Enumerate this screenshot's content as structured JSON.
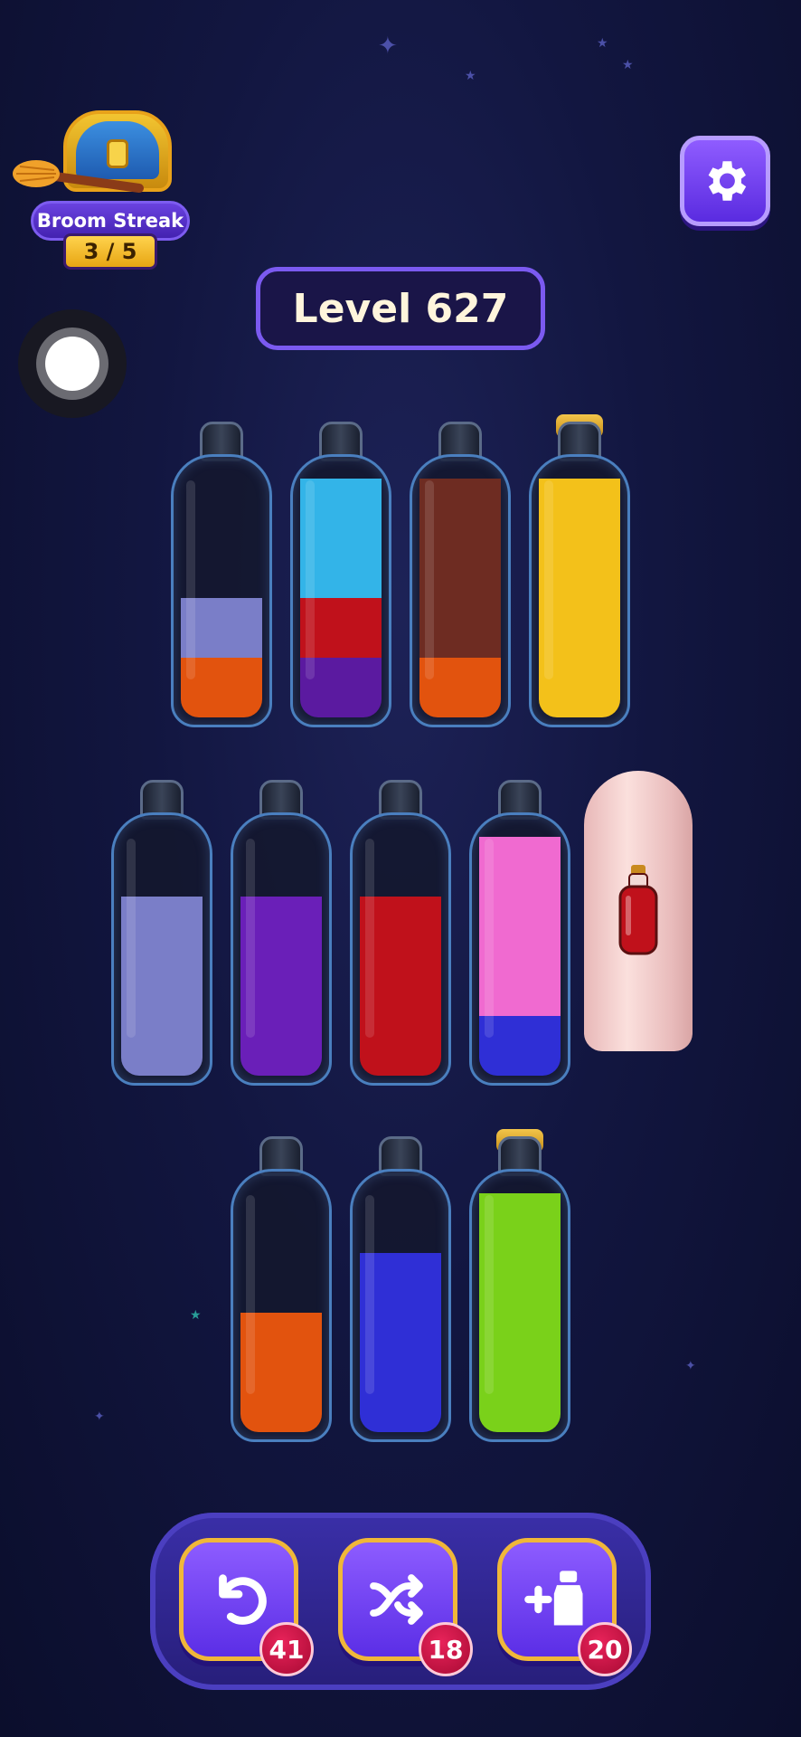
{
  "streak": {
    "label": "Broom Streak",
    "count": "3 / 5"
  },
  "level": {
    "title": "Level 627"
  },
  "icons": {
    "settings": "gear-icon",
    "undo": "undo-icon",
    "shuffle": "shuffle-icon",
    "add_tube": "add-bottle-icon"
  },
  "colors": {
    "orange": "#e2530e",
    "lavender": "#7a7ec8",
    "sky_blue": "#33b4e8",
    "red": "#c0111b",
    "purple": "#5b1aa0",
    "brown": "#6e2c22",
    "yellow": "#f3c11a",
    "violet": "#6a1fb8",
    "pink": "#f06ad0",
    "blue": "#2f2fd6",
    "green": "#7ad11a"
  },
  "bottles": [
    {
      "id": "b1",
      "layers": [
        "orange",
        "lavender"
      ],
      "corked": false
    },
    {
      "id": "b2",
      "layers": [
        "purple",
        "red",
        "sky_blue",
        "sky_blue"
      ],
      "corked": false
    },
    {
      "id": "b3",
      "layers": [
        "orange",
        "brown",
        "brown",
        "brown"
      ],
      "corked": false
    },
    {
      "id": "b4",
      "layers": [
        "yellow",
        "yellow",
        "yellow",
        "yellow"
      ],
      "corked": true
    },
    {
      "id": "b5",
      "layers": [
        "lavender",
        "lavender",
        "lavender"
      ],
      "corked": false
    },
    {
      "id": "b6",
      "layers": [
        "violet",
        "violet",
        "violet"
      ],
      "corked": false
    },
    {
      "id": "b7",
      "layers": [
        "red",
        "red",
        "red"
      ],
      "corked": false
    },
    {
      "id": "b8",
      "layers": [
        "blue",
        "pink",
        "pink",
        "pink"
      ],
      "corked": false
    },
    {
      "id": "b9",
      "layers": [
        "orange",
        "orange"
      ],
      "corked": false
    },
    {
      "id": "b10",
      "layers": [
        "blue",
        "blue",
        "blue"
      ],
      "corked": false
    },
    {
      "id": "b11",
      "layers": [
        "green",
        "green",
        "green",
        "green"
      ],
      "corked": true
    }
  ],
  "hidden_bottle": {
    "state": "covered"
  },
  "tools": {
    "undo_count": "41",
    "shuffle_count": "18",
    "add_tube_count": "20"
  }
}
